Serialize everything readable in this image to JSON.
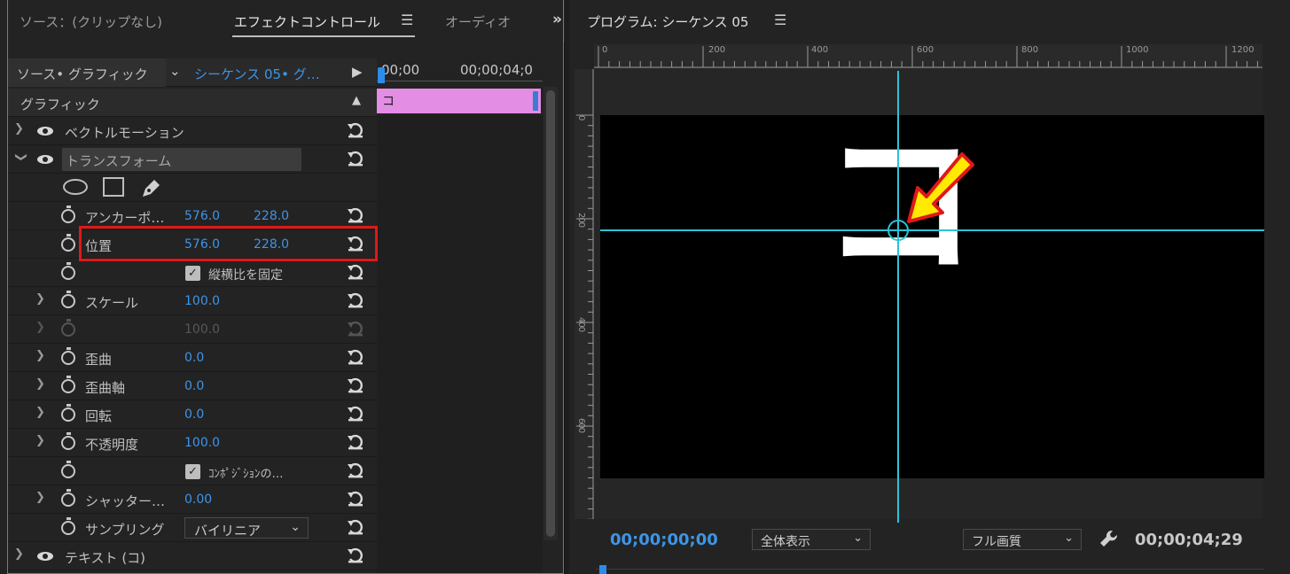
{
  "tabs": {
    "source": "ソース：(クリップなし)",
    "effect_controls": "エフェクトコントロール",
    "audio": "オーディオ",
    "menu_icon": "hamburger-icon",
    "more_icon": "chevron-double-right-icon"
  },
  "source_bar": {
    "source": "ソース• グラフィック",
    "sequence": "シーケンス 05• グ…",
    "time_start": "00;00",
    "time_end": "00;00;04;0"
  },
  "timeline_clip": {
    "label": "コ"
  },
  "effects": {
    "section_title": "グラフィック",
    "vector_motion": "ベクトルモーション",
    "transform": "トランスフォーム",
    "anchor": {
      "label": "アンカーポ…",
      "x": "576.0",
      "y": "228.0"
    },
    "position": {
      "label": "位置",
      "x": "576.0",
      "y": "228.0"
    },
    "lock_aspect": "縦横比を固定",
    "scale": {
      "label": "スケール",
      "value": "100.0"
    },
    "scale_width": {
      "value": "100.0"
    },
    "skew": {
      "label": "歪曲",
      "value": "0.0"
    },
    "skew_axis": {
      "label": "歪曲軸",
      "value": "0.0"
    },
    "rotation": {
      "label": "回転",
      "value": "0.0"
    },
    "opacity": {
      "label": "不透明度",
      "value": "100.0"
    },
    "composition": "ｺﾝﾎﾟｼﾞｼｮﾝの…",
    "shutter": {
      "label": "シャッター…",
      "value": "0.00"
    },
    "sampling": {
      "label": "サンプリング",
      "value": "バイリニア"
    },
    "text": "テキスト (コ)"
  },
  "program": {
    "title": "プログラム: シーケンス 05",
    "ruler_h": [
      "0",
      "200",
      "400",
      "600",
      "800",
      "1000",
      "1200"
    ],
    "ruler_v": [
      "0",
      "200",
      "400",
      "600"
    ],
    "glyph": "コ",
    "timecode_current": "00;00;00;00",
    "zoom": "全体表示",
    "quality": "フル画質",
    "timecode_duration": "00;00;04;29"
  },
  "colors": {
    "accent": "#2d8ceb",
    "value_blue": "#3d95e8",
    "clip_pink": "#e48de4",
    "guide_cyan": "#2bc3d8",
    "highlight_red": "#e01818",
    "arrow_yellow": "#ffea00"
  }
}
